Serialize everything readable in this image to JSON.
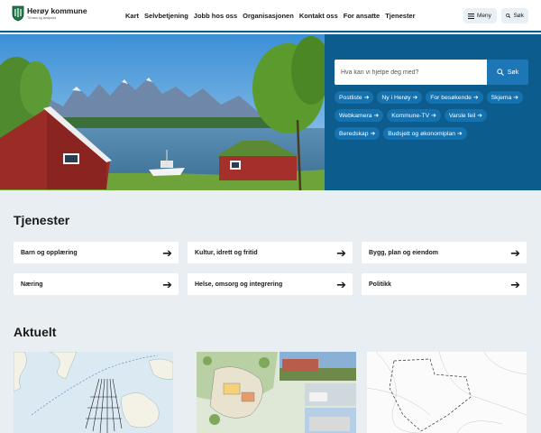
{
  "header": {
    "logo_name": "Herøy kommune",
    "logo_tagline": "Til havs og landjorda",
    "nav": [
      "Kart",
      "Selvbetjening",
      "Jobb hos oss",
      "Organisasjonen",
      "Kontakt oss",
      "For ansatte",
      "Tjenester"
    ],
    "menu_label": "Meny",
    "search_label": "Søk"
  },
  "hero": {
    "search_placeholder": "Hva kan vi hjelpe deg med?",
    "search_button": "Søk",
    "quick_links": [
      "Postliste",
      "Ny i Herøy",
      "For besøkende",
      "Skjema",
      "Webkamera",
      "Kommune-TV",
      "Varsle feil",
      "Beredskap",
      "Budsjett og økonomiplan"
    ]
  },
  "services": {
    "title": "Tjenester",
    "items": [
      "Barn og opplæring",
      "Kultur, idrett og fritid",
      "Bygg, plan og eiendom",
      "Næring",
      "Helse, omsorg og integrering",
      "Politikk"
    ]
  },
  "news": {
    "title": "Aktuelt"
  },
  "colors": {
    "brand_blue": "#0d5c8e",
    "chip_blue": "#1672ae",
    "button_blue": "#1d76b6",
    "page_bg": "#e9eef2"
  },
  "icons": [
    "logo-shield-icon",
    "menu-icon",
    "search-icon",
    "arrow-right-icon"
  ]
}
